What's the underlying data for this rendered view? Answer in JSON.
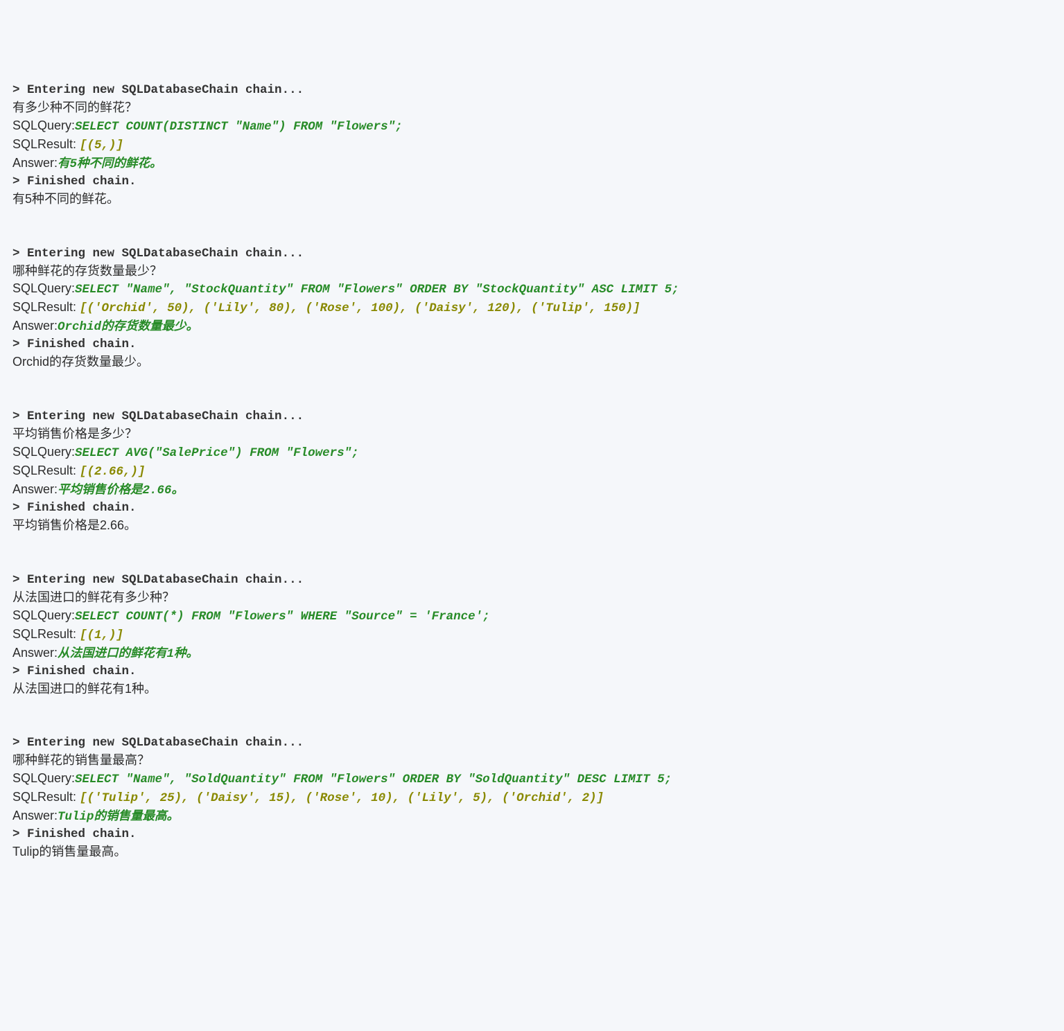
{
  "commonLabels": {
    "entering": "> Entering new SQLDatabaseChain chain...",
    "sqlQueryLabel": "SQLQuery:",
    "sqlResultLabel": "SQLResult: ",
    "answerLabel": "Answer:",
    "finished": "> Finished chain."
  },
  "blocks": [
    {
      "question": "有多少种不同的鲜花？",
      "sqlQuery": "SELECT COUNT(DISTINCT \"Name\") FROM \"Flowers\";",
      "sqlResult": "[(5,)]",
      "answer": "有5种不同的鲜花。",
      "finalOutput": "有5种不同的鲜花。"
    },
    {
      "question": "哪种鲜花的存货数量最少？",
      "sqlQuery": "SELECT \"Name\", \"StockQuantity\" FROM \"Flowers\" ORDER BY \"StockQuantity\" ASC LIMIT 5;",
      "sqlResult": "[('Orchid', 50), ('Lily', 80), ('Rose', 100), ('Daisy', 120), ('Tulip', 150)]",
      "answer": "Orchid的存货数量最少。",
      "finalOutput": "Orchid的存货数量最少。"
    },
    {
      "question": "平均销售价格是多少？",
      "sqlQuery": "SELECT AVG(\"SalePrice\") FROM \"Flowers\";",
      "sqlResult": "[(2.66,)]",
      "answer": "平均销售价格是2.66。",
      "finalOutput": "平均销售价格是2.66。"
    },
    {
      "question": "从法国进口的鲜花有多少种？",
      "sqlQuery": "SELECT COUNT(*) FROM \"Flowers\" WHERE \"Source\" = 'France';",
      "sqlResult": "[(1,)]",
      "answer": "从法国进口的鲜花有1种。",
      "finalOutput": "从法国进口的鲜花有1种。"
    },
    {
      "question": "哪种鲜花的销售量最高？",
      "sqlQuery": "SELECT \"Name\", \"SoldQuantity\" FROM \"Flowers\" ORDER BY \"SoldQuantity\" DESC LIMIT 5;",
      "sqlResult": "[('Tulip', 25), ('Daisy', 15), ('Rose', 10), ('Lily', 5), ('Orchid', 2)]",
      "answer": "Tulip的销售量最高。",
      "finalOutput": "Tulip的销售量最高。"
    }
  ]
}
